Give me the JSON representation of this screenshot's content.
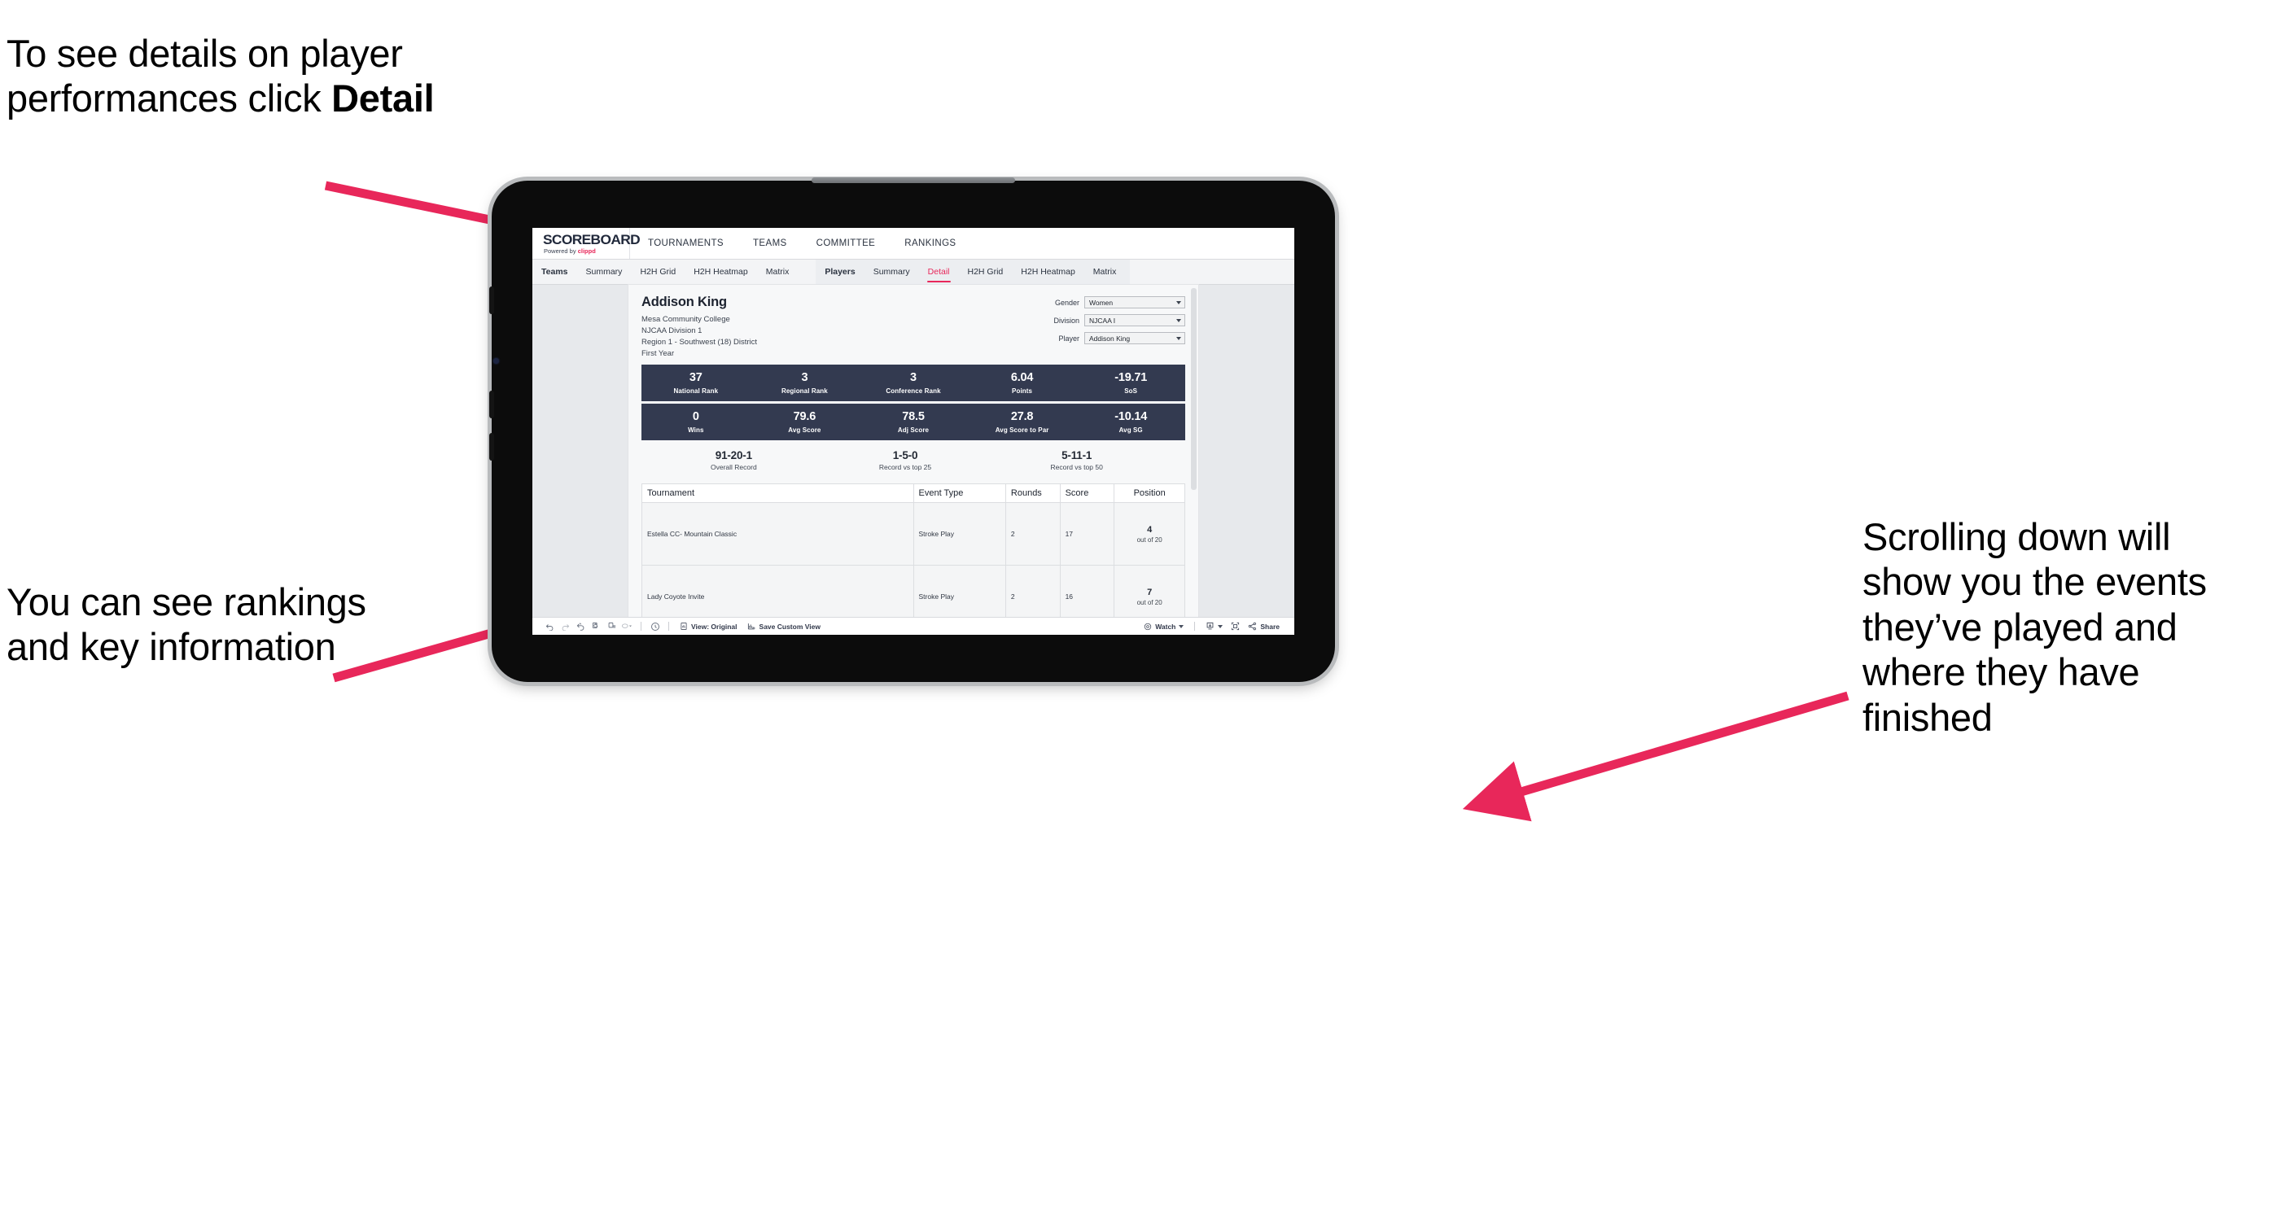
{
  "annotations": {
    "top_left": "To see details on player performances click ",
    "top_left_bold": "Detail",
    "mid_left": "You can see rankings and key information",
    "right": "Scrolling down will show you the events they’ve played and where they have finished",
    "arrow_color": "#e8275a"
  },
  "site": {
    "brand": {
      "title": "SCOREBOARD",
      "powered_prefix": "Powered by ",
      "powered_brand": "clippd"
    },
    "top_nav": [
      "TOURNAMENTS",
      "TEAMS",
      "COMMITTEE",
      "RANKINGS"
    ],
    "sub_nav_group_1": [
      "Teams",
      "Summary",
      "H2H Grid",
      "H2H Heatmap",
      "Matrix"
    ],
    "sub_nav_group_2": [
      "Players",
      "Summary",
      "Detail",
      "H2H Grid",
      "H2H Heatmap",
      "Matrix"
    ],
    "sub_nav_active": "Detail"
  },
  "player": {
    "name": "Addison King",
    "school": "Mesa Community College",
    "division": "NJCAA Division 1",
    "region": "Region 1 - Southwest (18) District",
    "year": "First Year"
  },
  "filters": [
    {
      "label": "Gender",
      "value": "Women"
    },
    {
      "label": "Division",
      "value": "NJCAA I"
    },
    {
      "label": "Player",
      "value": "Addison King"
    }
  ],
  "stats_row_1": [
    {
      "value": "37",
      "label": "National Rank"
    },
    {
      "value": "3",
      "label": "Regional Rank"
    },
    {
      "value": "3",
      "label": "Conference Rank"
    },
    {
      "value": "6.04",
      "label": "Points"
    },
    {
      "value": "-19.71",
      "label": "SoS"
    }
  ],
  "stats_row_2": [
    {
      "value": "0",
      "label": "Wins"
    },
    {
      "value": "79.6",
      "label": "Avg Score"
    },
    {
      "value": "78.5",
      "label": "Adj Score"
    },
    {
      "value": "27.8",
      "label": "Avg Score to Par"
    },
    {
      "value": "-10.14",
      "label": "Avg SG"
    }
  ],
  "records": [
    {
      "value": "91-20-1",
      "label": "Overall Record"
    },
    {
      "value": "1-5-0",
      "label": "Record vs top 25"
    },
    {
      "value": "5-11-1",
      "label": "Record vs top 50"
    }
  ],
  "table": {
    "headers": [
      "Tournament",
      "Event Type",
      "Rounds",
      "Score",
      "Position"
    ],
    "rows": [
      {
        "tournament": "Estella CC- Mountain Classic",
        "event_type": "Stroke Play",
        "rounds": "2",
        "score": "17",
        "position_num": "4",
        "position_sub": "out of 20"
      },
      {
        "tournament": "Lady Coyote Invite",
        "event_type": "Stroke Play",
        "rounds": "2",
        "score": "16",
        "position_num": "7",
        "position_sub": "out of 20"
      }
    ]
  },
  "toolbar": {
    "view_label": "View: Original",
    "save_label": "Save Custom View",
    "watch_label": "Watch",
    "share_label": "Share"
  },
  "colors": {
    "accent": "#e8275a",
    "stat_band": "#333a50",
    "screen_bg": "#e7e9ec"
  }
}
